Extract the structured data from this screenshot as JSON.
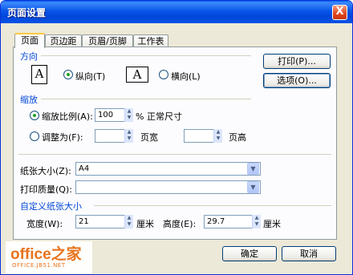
{
  "title": "页面设置",
  "close_label": "X",
  "tabs": [
    {
      "label": "页面",
      "active": true
    },
    {
      "label": "页边距",
      "active": false
    },
    {
      "label": "页眉/页脚",
      "active": false
    },
    {
      "label": "工作表",
      "active": false
    }
  ],
  "orientation": {
    "label": "方向",
    "portrait_icon": "A",
    "landscape_icon": "A",
    "portrait_label": "纵向(T)",
    "landscape_label": "横向(L)",
    "selected": "portrait"
  },
  "side_buttons": {
    "print": "打印(P)...",
    "options": "选项(O)..."
  },
  "scaling": {
    "label": "缩放",
    "adjust_label": "缩放比例(A):",
    "adjust_value": "100",
    "adjust_suffix": "% 正常尺寸",
    "fit_label": "调整为(F):",
    "fit_wide_value": "",
    "fit_wide_suffix": "页宽",
    "fit_tall_value": "",
    "fit_tall_suffix": "页高",
    "selected": "adjust"
  },
  "paper_size": {
    "label": "纸张大小(Z):",
    "value": "A4"
  },
  "print_quality": {
    "label": "打印质量(Q):",
    "value": ""
  },
  "custom_size": {
    "label": "自定义纸张大小",
    "width_label": "宽度(W):",
    "width_value": "21",
    "height_label": "高度(E):",
    "height_value": "29.7",
    "unit": "厘米"
  },
  "footer": {
    "ok": "确定",
    "cancel": "取消"
  },
  "watermark": {
    "brand": "office之家",
    "url": "OFFICE.JB51.NET"
  },
  "colors": {
    "accent": "#0046d5",
    "titlebar": "#0a56e8",
    "close": "#e0461f",
    "dialog_bg": "#ece9d8"
  },
  "icons": [
    "close-icon",
    "portrait-page-icon",
    "landscape-page-icon",
    "spinner-icon",
    "chevron-down-icon"
  ]
}
